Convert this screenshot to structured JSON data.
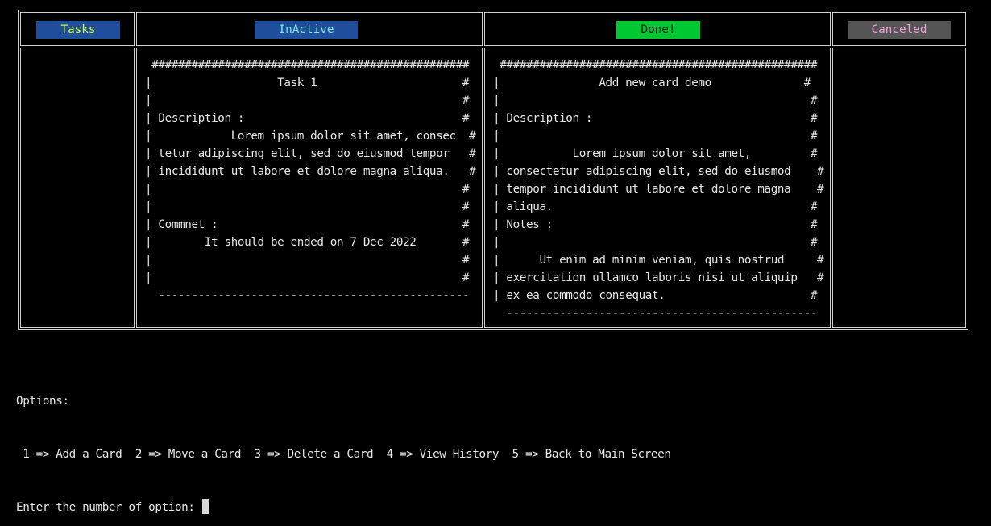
{
  "colors": {
    "background": "#000000",
    "border": "#d0d0d0",
    "text": "#e6e6e6",
    "tasks_header_bg": "#1f4e9c",
    "tasks_header_fg": "#c8ff3a",
    "inactive_header_bg": "#1f4e9c",
    "inactive_header_fg": "#7ee8e0",
    "done_header_bg": "#00c832",
    "done_header_fg": "#1a1a1a",
    "canceled_header_bg": "#555555",
    "canceled_header_fg": "#f0a0d8"
  },
  "board": {
    "columns": [
      {
        "id": "tasks",
        "header": "Tasks"
      },
      {
        "id": "inactive",
        "header": "InActive"
      },
      {
        "id": "done",
        "header": "Done!"
      },
      {
        "id": "canceled",
        "header": "Canceled"
      }
    ]
  },
  "cards": {
    "inactive_card": [
      " ################################################",
      "|                   Task 1                      #",
      "|                                               #",
      "| Description :                                 #",
      "|            Lorem ipsum dolor sit amet, consec  #",
      "| tetur adipiscing elit, sed do eiusmod tempor   #",
      "| incididunt ut labore et dolore magna aliqua.   #",
      "|                                               #",
      "|                                               #",
      "| Commnet :                                     #",
      "|        It should be ended on 7 Dec 2022       #",
      "|                                               #",
      "|                                               #",
      "  -----------------------------------------------"
    ],
    "done_card": [
      " ################################################",
      "|               Add new card demo              #",
      "|                                               #",
      "| Description :                                 #",
      "|                                               #",
      "|           Lorem ipsum dolor sit amet,         #",
      "| consectetur adipiscing elit, sed do eiusmod    #",
      "| tempor incididunt ut labore et dolore magna    #",
      "| aliqua.                                       #",
      "| Notes :                                       #",
      "|                                               #",
      "|      Ut enim ad minim veniam, quis nostrud     #",
      "| exercitation ullamco laboris nisi ut aliquip   #",
      "| ex ea commodo consequat.                      #",
      "  -----------------------------------------------"
    ]
  },
  "console": {
    "options_label": "Options:",
    "options_line": " 1 => Add a Card  2 => Move a Card  3 => Delete a Card  4 => View History  5 => Back to Main Screen",
    "prompt": "Enter the number of option: ",
    "input_value": ""
  }
}
